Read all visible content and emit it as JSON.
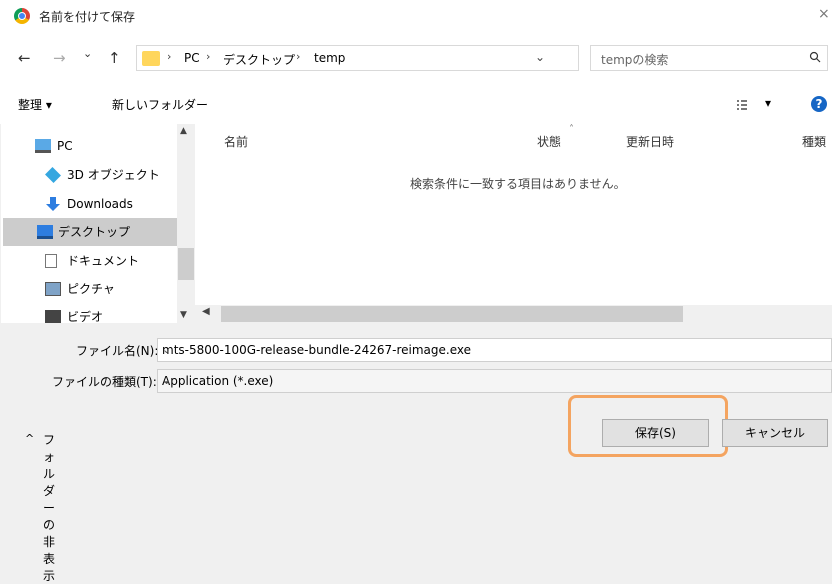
{
  "window": {
    "title": "名前を付けて保存",
    "close_label": "×"
  },
  "nav": {
    "back": "←",
    "forward": "→",
    "history": "⌄",
    "up": "↑",
    "path": [
      "PC",
      "デスクトップ",
      "temp"
    ],
    "separator": "›",
    "refresh": "↻",
    "dropdown": "⌄",
    "search_placeholder": "tempの検索"
  },
  "toolbar": {
    "organize": "整理 ▾",
    "new_folder": "新しいフォルダー",
    "view": "▾",
    "help": "?"
  },
  "tree": [
    {
      "label": "PC",
      "icon": "pc-icon"
    },
    {
      "label": "3D オブジェクト",
      "icon": "3d-objects-icon"
    },
    {
      "label": "Downloads",
      "icon": "download-icon"
    },
    {
      "label": "デスクトップ",
      "icon": "desktop-icon",
      "selected": true
    },
    {
      "label": "ドキュメント",
      "icon": "document-icon"
    },
    {
      "label": "ピクチャ",
      "icon": "pictures-icon"
    },
    {
      "label": "ビデオ",
      "icon": "video-icon"
    }
  ],
  "list": {
    "columns": [
      "名前",
      "状態",
      "更新日時",
      "種類"
    ],
    "empty_message": "検索条件に一致する項目はありません。"
  },
  "fields": {
    "filename_label": "ファイル名(N):",
    "filename_value": "mts-5800-100G-release-bundle-24267-reimage.exe",
    "filetype_label": "ファイルの種類(T):",
    "filetype_value": "Application (*.exe)"
  },
  "footer": {
    "hide_folders": "フォルダーの非表示",
    "hide_caret": "^",
    "save": "保存(S)",
    "cancel": "キャンセル"
  },
  "colors": {
    "accent": "#1666c5",
    "highlight": "#f4a460"
  }
}
